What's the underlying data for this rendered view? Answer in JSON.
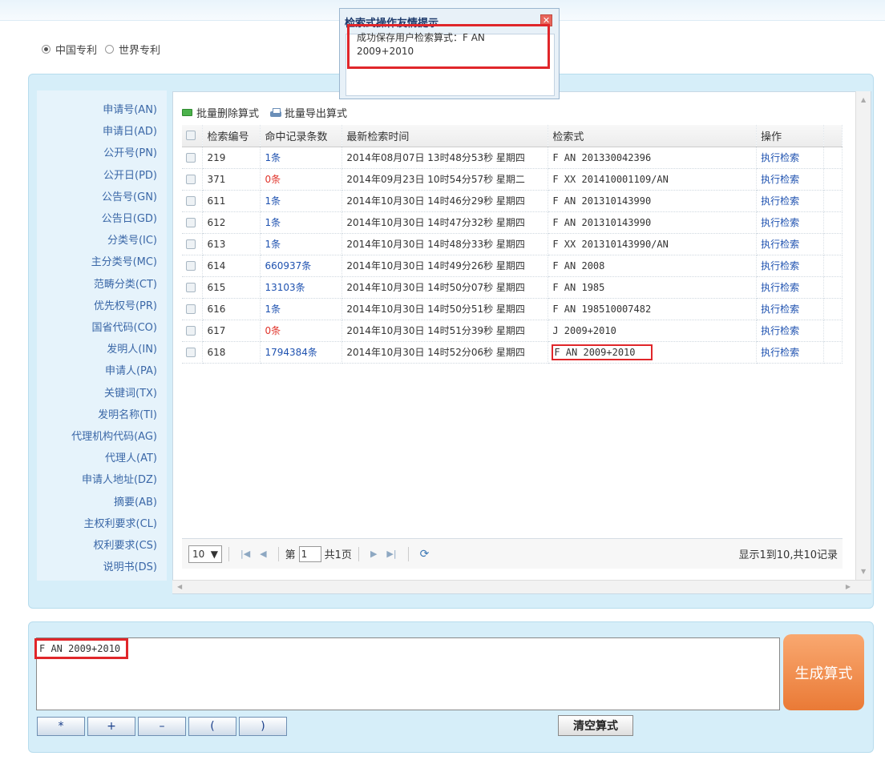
{
  "scope": {
    "options": [
      {
        "label": "中国专利",
        "selected": true
      },
      {
        "label": "世界专利",
        "selected": false
      }
    ]
  },
  "fields": [
    "申请号(AN)",
    "申请日(AD)",
    "公开号(PN)",
    "公开日(PD)",
    "公告号(GN)",
    "公告日(GD)",
    "分类号(IC)",
    "主分类号(MC)",
    "范畴分类(CT)",
    "优先权号(PR)",
    "国省代码(CO)",
    "发明人(IN)",
    "申请人(PA)",
    "关键词(TX)",
    "发明名称(TI)",
    "代理机构代码(AG)",
    "代理人(AT)",
    "申请人地址(DZ)",
    "摘要(AB)",
    "主权利要求(CL)",
    "权利要求(CS)",
    "说明书(DS)"
  ],
  "toolbar": {
    "batch_delete": "批量删除算式",
    "batch_export": "批量导出算式"
  },
  "grid": {
    "headers": [
      "检索编号",
      "命中记录条数",
      "最新检索时间",
      "检索式",
      "操作"
    ],
    "rows": [
      {
        "id": "219",
        "hits": "1条",
        "time": "2014年08月07日 13时48分53秒 星期四",
        "expr": "F AN 201330042396",
        "action": "执行检索"
      },
      {
        "id": "371",
        "hits": "0条",
        "time": "2014年09月23日 10时54分57秒 星期二",
        "expr": "F XX 201410001109/AN",
        "action": "执行检索"
      },
      {
        "id": "611",
        "hits": "1条",
        "time": "2014年10月30日 14时46分29秒 星期四",
        "expr": "F AN 201310143990",
        "action": "执行检索"
      },
      {
        "id": "612",
        "hits": "1条",
        "time": "2014年10月30日 14时47分32秒 星期四",
        "expr": "F AN 201310143990",
        "action": "执行检索"
      },
      {
        "id": "613",
        "hits": "1条",
        "time": "2014年10月30日 14时48分33秒 星期四",
        "expr": "F XX 201310143990/AN",
        "action": "执行检索"
      },
      {
        "id": "614",
        "hits": "660937条",
        "time": "2014年10月30日 14时49分26秒 星期四",
        "expr": "F AN 2008",
        "action": "执行检索"
      },
      {
        "id": "615",
        "hits": "13103条",
        "time": "2014年10月30日 14时50分07秒 星期四",
        "expr": "F AN 1985",
        "action": "执行检索"
      },
      {
        "id": "616",
        "hits": "1条",
        "time": "2014年10月30日 14时50分51秒 星期四",
        "expr": "F AN 198510007482",
        "action": "执行检索"
      },
      {
        "id": "617",
        "hits": "0条",
        "time": "2014年10月30日 14时51分39秒 星期四",
        "expr": "J 2009+2010",
        "action": "执行检索"
      },
      {
        "id": "618",
        "hits": "1794384条",
        "time": "2014年10月30日 14时52分06秒 星期四",
        "expr": "F AN 2009+2010",
        "action": "执行检索"
      }
    ]
  },
  "pager": {
    "page_size": "10",
    "page_label": "第",
    "page_value": "1",
    "total_pages": "共1页",
    "info": "显示1到10,共10记录"
  },
  "expression": {
    "value": "F AN 2009+2010",
    "generate_label": "生成算式",
    "clear_label": "清空算式",
    "ops": [
      "*",
      "+",
      "–",
      "(",
      ")"
    ]
  },
  "dialog": {
    "title": "检索式操作友情提示",
    "message_line1": "成功保存用户检索算式：F AN",
    "message_line2": "2009+2010"
  },
  "colors": {
    "accent": "#1f52b0",
    "zero_hits": "#e0342b",
    "highlight": "#e0262a",
    "generate_button": "#ef8a46"
  }
}
